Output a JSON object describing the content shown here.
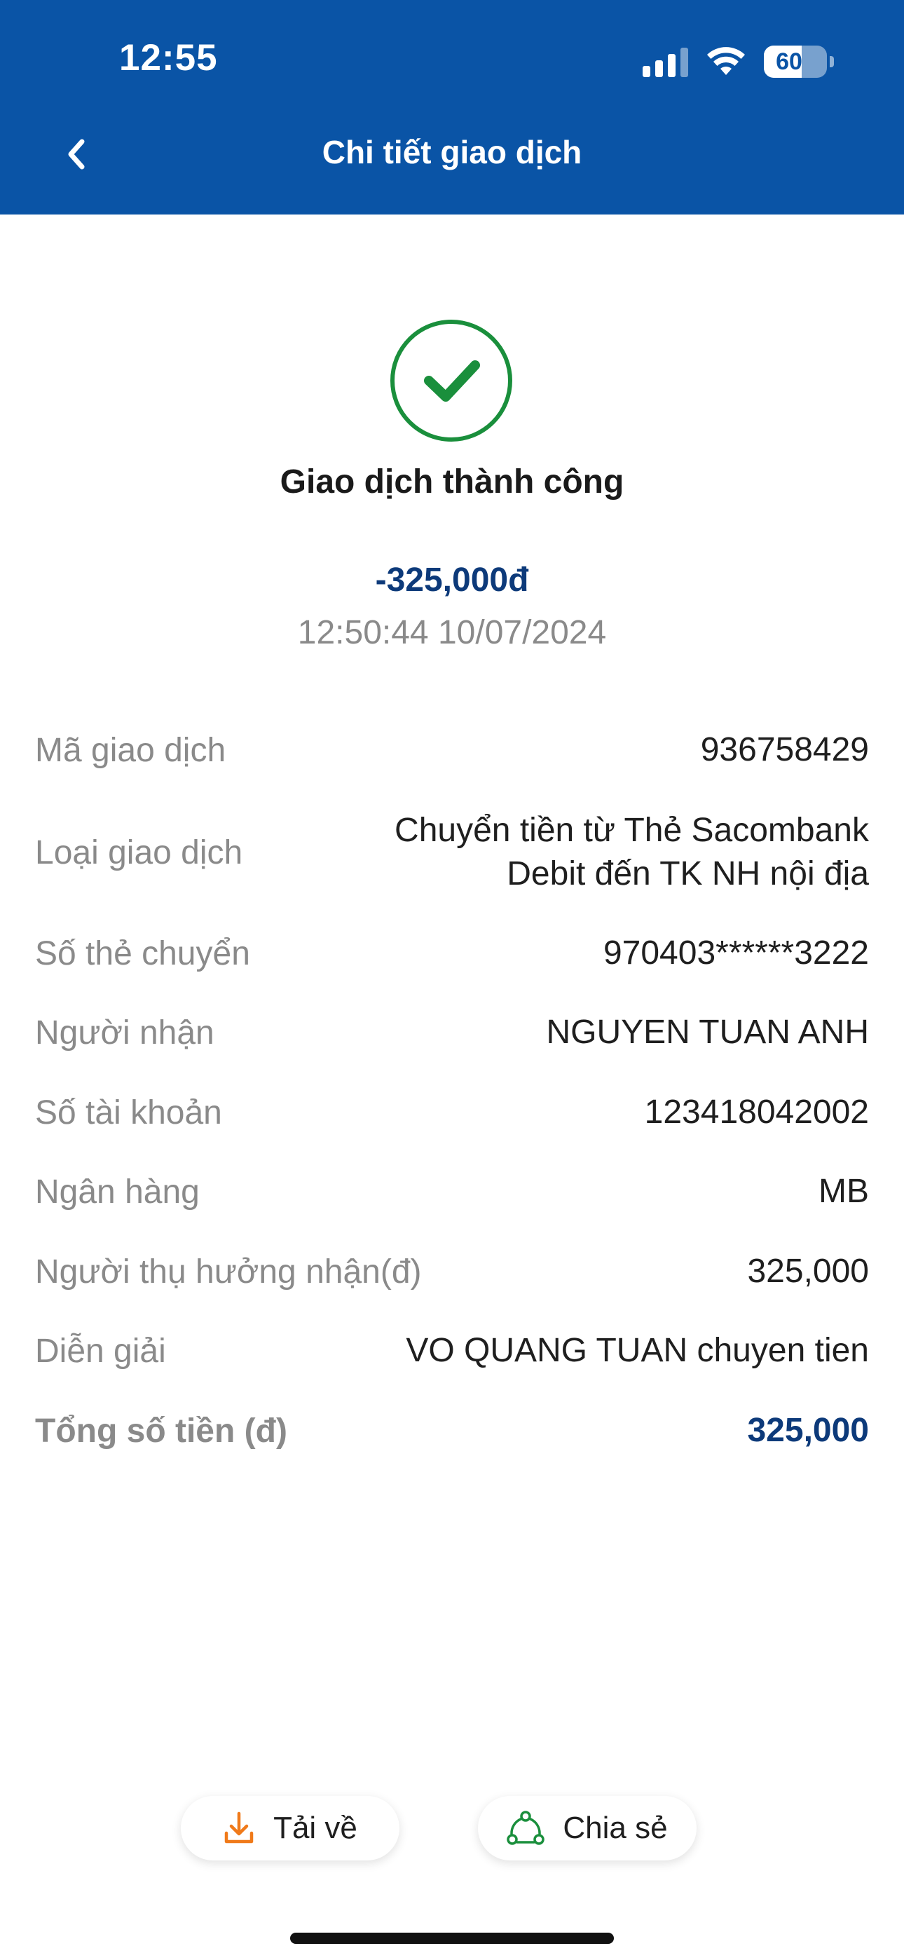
{
  "status_bar": {
    "time": "12:55",
    "battery": "60"
  },
  "header": {
    "title": "Chi tiết giao dịch"
  },
  "result": {
    "status_text": "Giao dịch thành công",
    "amount": "-325,000đ",
    "datetime": "12:50:44 10/07/2024"
  },
  "details": [
    {
      "label": "Mã giao dịch",
      "value": "936758429"
    },
    {
      "label": "Loại giao dịch",
      "value_line1": "Chuyển tiền từ Thẻ Sacombank",
      "value_line2": "Debit đến TK NH nội địa"
    },
    {
      "label": "Số thẻ chuyển",
      "value": "970403******3222"
    },
    {
      "label": "Người nhận",
      "value": "NGUYEN TUAN ANH"
    },
    {
      "label": "Số tài khoản",
      "value": "123418042002"
    },
    {
      "label": "Ngân hàng",
      "value": "MB"
    },
    {
      "label": "Người thụ hưởng nhận(đ)",
      "value": "325,000"
    },
    {
      "label": "Diễn giải",
      "value": "VO QUANG TUAN chuyen tien"
    },
    {
      "label": "Tổng số tiền (đ)",
      "value": "325,000"
    }
  ],
  "actions": {
    "download_label": "Tải về",
    "share_label": "Chia sẻ"
  },
  "colors": {
    "header_bg": "#0a54a6",
    "success_green": "#1a8f3c",
    "amount_blue": "#0d3a7a",
    "download_orange": "#f07a1a"
  }
}
